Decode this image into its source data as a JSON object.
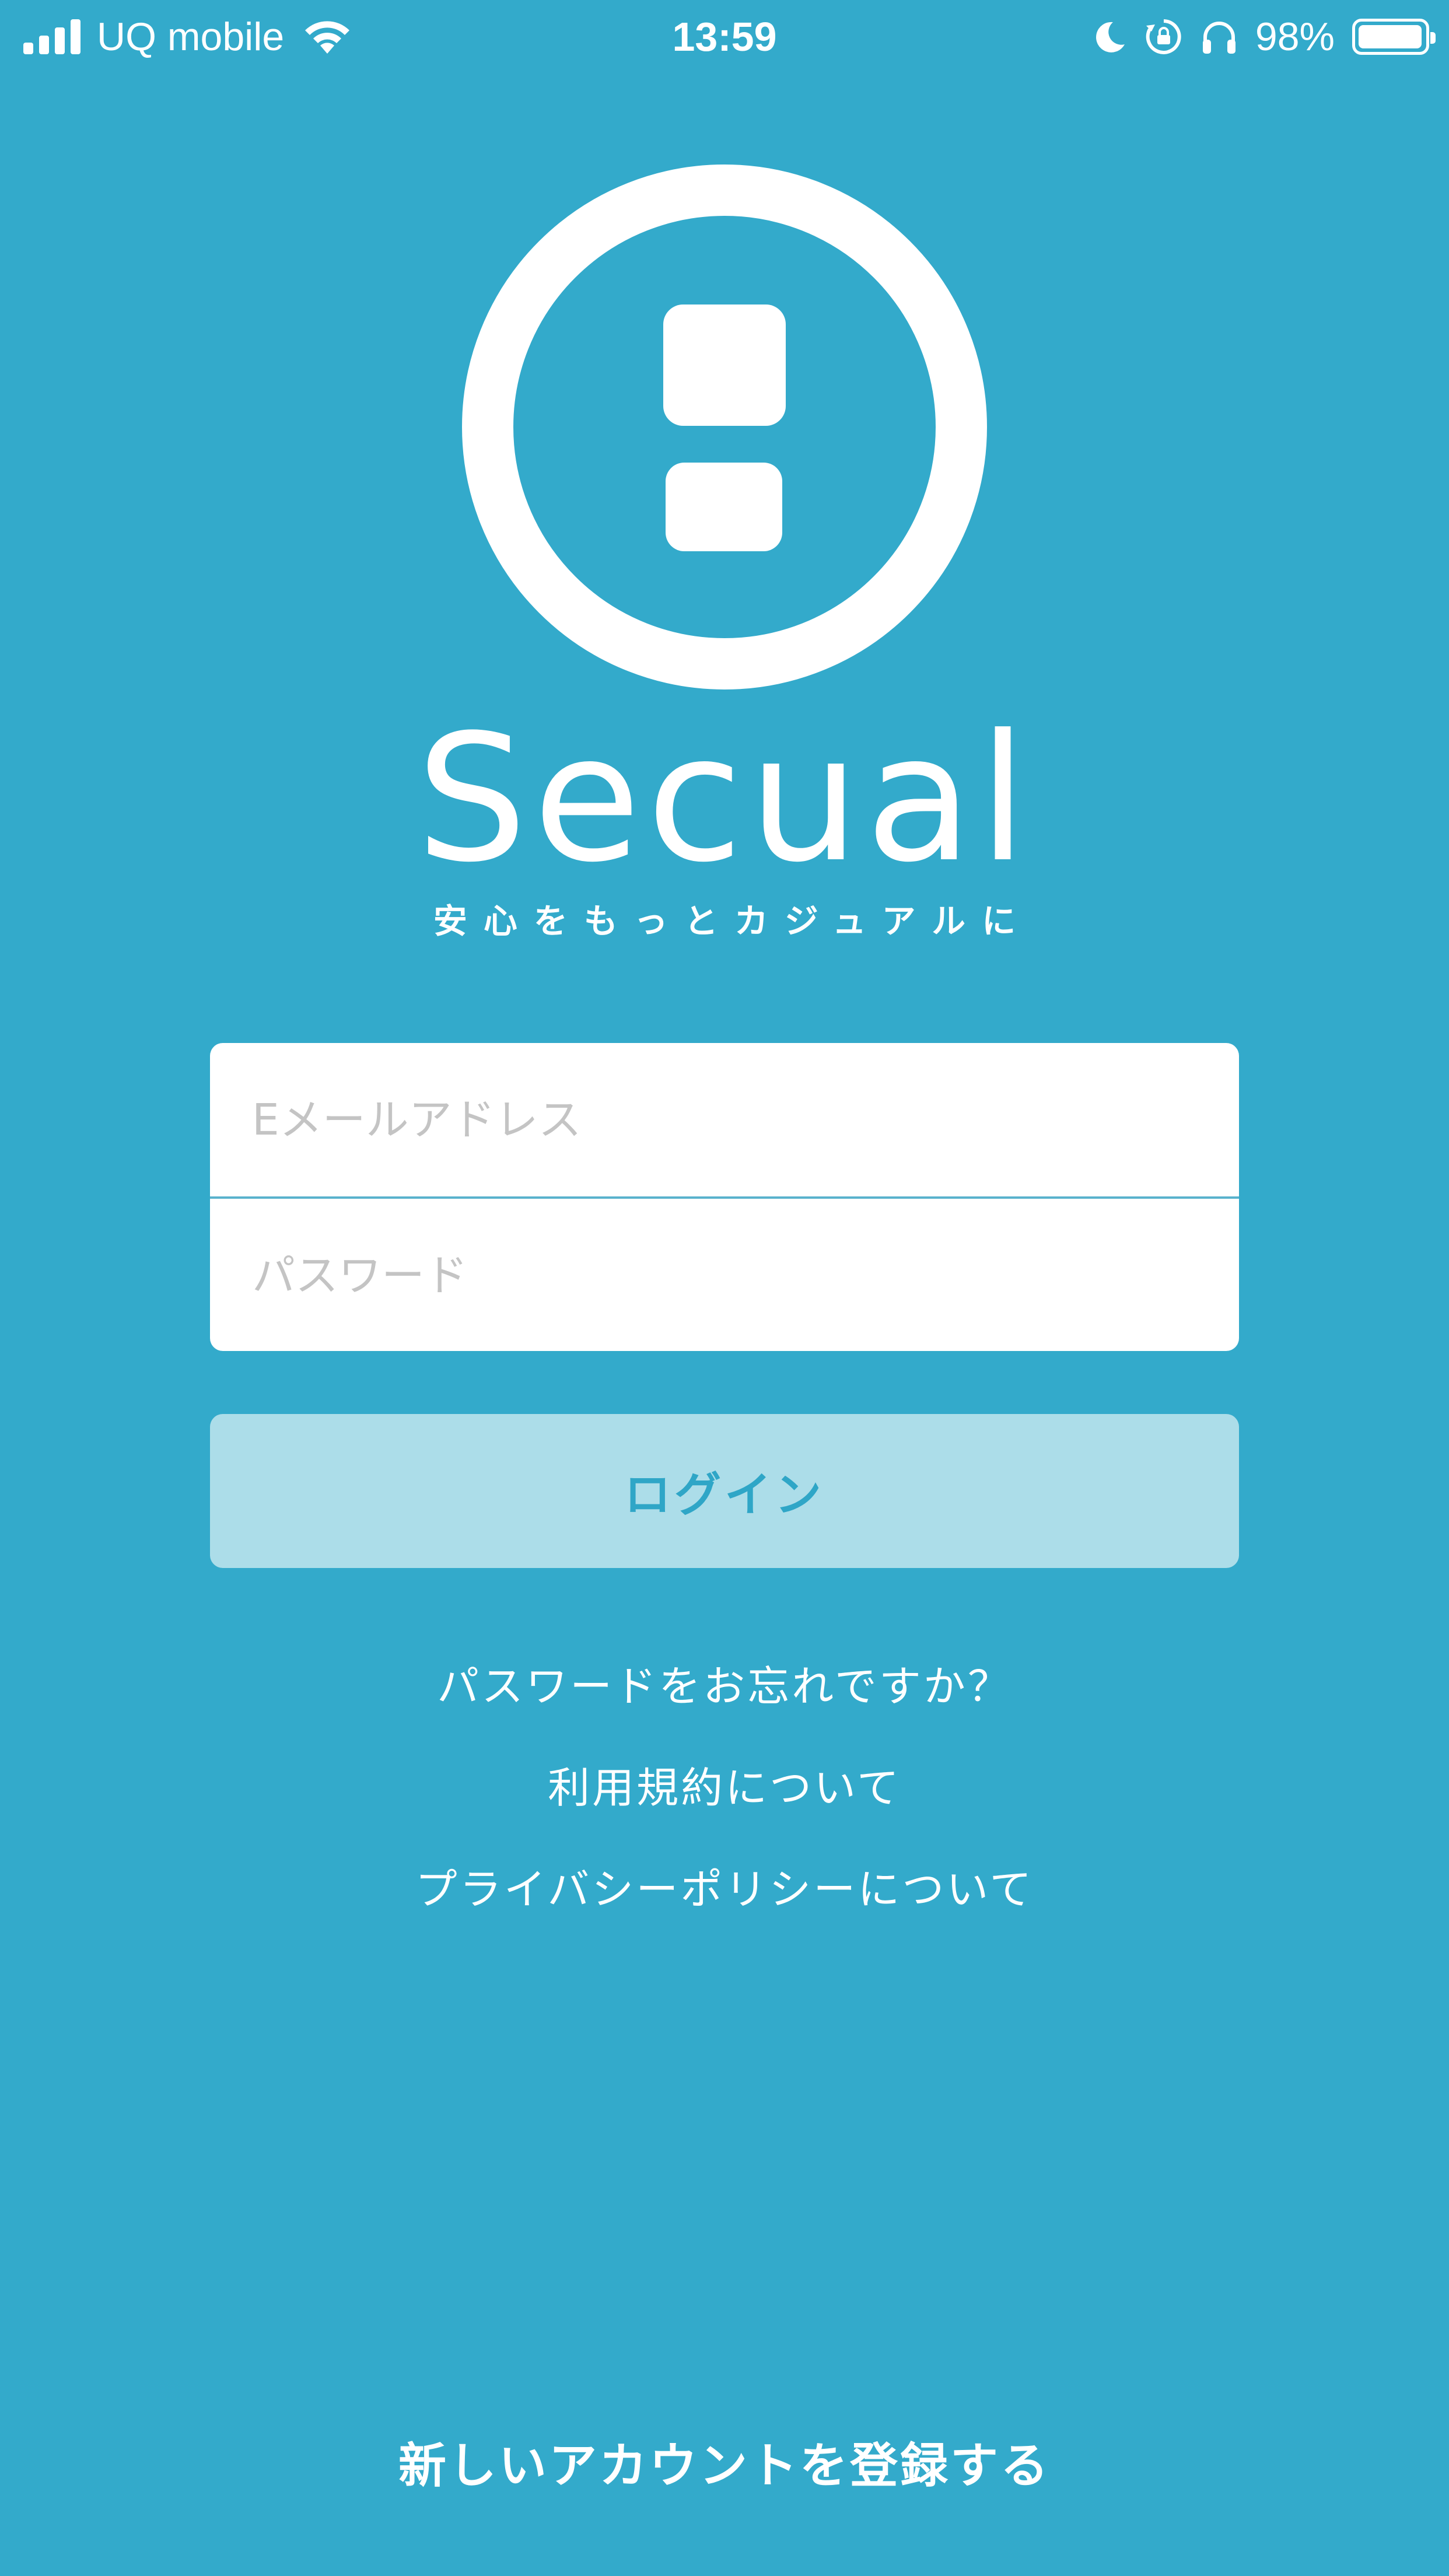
{
  "status_bar": {
    "carrier": "UQ mobile",
    "time": "13:59",
    "battery": "98%",
    "battery_level": 0.98,
    "icons": [
      "cellular-signal-icon",
      "wifi-icon",
      "moon-icon",
      "rotation-lock-icon",
      "headphones-icon",
      "battery-icon"
    ]
  },
  "brand": {
    "name": "Secual",
    "tagline": "安心をもっとカジュアルに",
    "logo_icon": "secual-logo-icon"
  },
  "form": {
    "email_placeholder": "Eメールアドレス",
    "email_value": "",
    "password_placeholder": "パスワード",
    "password_value": "",
    "login_label": "ログイン"
  },
  "links": {
    "forgot_password": "パスワードをお忘れですか？",
    "terms": "利用規約について",
    "privacy": "プライバシーポリシーについて",
    "register": "新しいアカウントを登録する"
  },
  "colors": {
    "background": "#33aacb",
    "button_background": "#acdde9",
    "button_text": "#2fa6c7",
    "field_background": "#ffffff",
    "placeholder": "#c4c4c4"
  }
}
